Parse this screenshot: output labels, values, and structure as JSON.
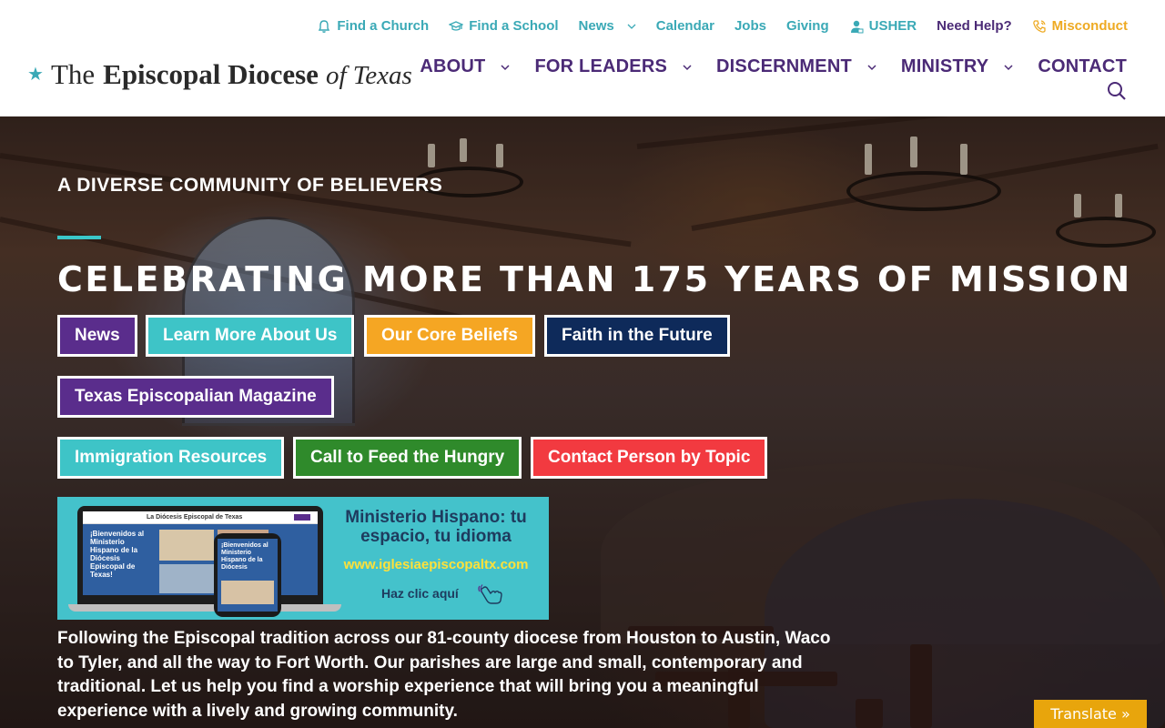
{
  "utility_nav": {
    "find_church": "Find a Church",
    "find_school": "Find a School",
    "news": "News",
    "calendar": "Calendar",
    "jobs": "Jobs",
    "giving": "Giving",
    "usher": "USHER",
    "need_help": "Need Help?",
    "misconduct": "Misconduct"
  },
  "logo": {
    "star": "★",
    "the": "The",
    "name": "Episcopal Diocese",
    "of_texas": "of Texas"
  },
  "main_nav": {
    "about": "ABOUT",
    "for_leaders": "FOR LEADERS",
    "discernment": "DISCERNMENT",
    "ministry": "MINISTRY",
    "contact": "CONTACT"
  },
  "hero": {
    "tagline": "A DIVERSE COMMUNITY OF BELIEVERS",
    "headline": "CELEBRATING MORE THAN 175 YEARS OF MISSION",
    "body": "Following the Episcopal tradition across our 81-county diocese from Houston to Austin, Waco to Tyler, and all the way to Fort Worth. Our parishes are large and small, contemporary and traditional. Let us help you find a worship experience that will bring you a meaningful experience with a lively and growing community."
  },
  "buttons": {
    "news": "News",
    "learn_more": "Learn More About Us",
    "core_beliefs": "Our Core Beliefs",
    "faith_future": "Faith in the Future",
    "magazine": "Texas Episcopalian Magazine",
    "immigration": "Immigration Resources",
    "feed_hungry": "Call to Feed the Hungry",
    "contact_topic": "Contact Person by Topic"
  },
  "promo": {
    "title": "Ministerio Hispano: tu espacio, tu idioma",
    "url": "www.iglesiaepiscopaltx.com",
    "cta": "Haz clic aquí",
    "screen_header": "La Diócesis Episcopal de Texas",
    "screen_text": "¡Bienvenidos al Ministerio Hispano de la Diócesis Episcopal de Texas!",
    "phone_text": "¡Bienvenidos al Ministerio Hispano de la Diócesis"
  },
  "translate": "Translate »",
  "colors": {
    "teal": "#3aa9b6",
    "purple": "#4b2a76",
    "gold": "#eeaa22",
    "btn_purple": "#5a2d8c",
    "btn_teal": "#3ec4c7",
    "btn_orange": "#f5a623",
    "btn_navy": "#0e2a5a",
    "btn_green": "#2f8a2b",
    "btn_red": "#f23a40",
    "promo_bg": "#44c2cb"
  },
  "icons": {
    "find_church": "bell-icon",
    "find_school": "graduation-cap-icon",
    "usher": "user-badge-icon",
    "misconduct": "phone-icon",
    "dropdown": "chevron-down-icon",
    "search": "search-icon",
    "cta": "pointing-hand-icon"
  }
}
